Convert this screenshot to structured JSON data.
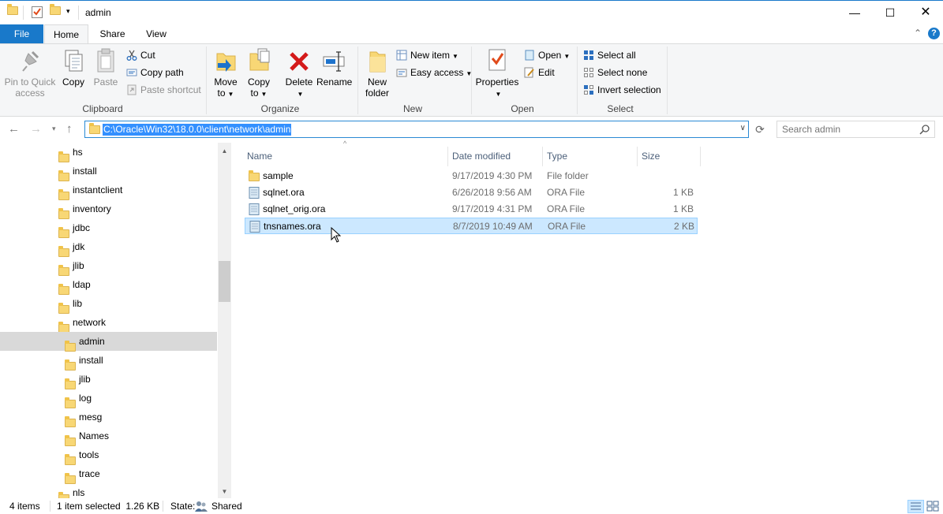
{
  "window": {
    "title": "admin"
  },
  "ribbon_tabs": [
    "File",
    "Home",
    "Share",
    "View"
  ],
  "ribbon": {
    "clipboard": {
      "label": "Clipboard",
      "pin": "Pin to Quick access",
      "pin_l1": "Pin to Quick",
      "pin_l2": "access",
      "copy": "Copy",
      "paste": "Paste",
      "cut": "Cut",
      "copy_path": "Copy path",
      "paste_shortcut": "Paste shortcut"
    },
    "organize": {
      "label": "Organize",
      "move_l1": "Move",
      "move_l2": "to",
      "copy_l1": "Copy",
      "copy_l2": "to",
      "delete": "Delete",
      "rename": "Rename"
    },
    "new": {
      "label": "New",
      "new_folder_l1": "New",
      "new_folder_l2": "folder",
      "new_item": "New item",
      "easy_access": "Easy access"
    },
    "open": {
      "label": "Open",
      "properties": "Properties",
      "open": "Open",
      "edit": "Edit"
    },
    "select": {
      "label": "Select",
      "select_all": "Select all",
      "select_none": "Select none",
      "invert": "Invert selection"
    }
  },
  "address": {
    "path": "C:\\Oracle\\Win32\\18.0.0\\client\\network\\admin",
    "search_placeholder": "Search admin"
  },
  "tree": [
    {
      "label": "hs",
      "level": 0
    },
    {
      "label": "install",
      "level": 0
    },
    {
      "label": "instantclient",
      "level": 0
    },
    {
      "label": "inventory",
      "level": 0
    },
    {
      "label": "jdbc",
      "level": 0
    },
    {
      "label": "jdk",
      "level": 0
    },
    {
      "label": "jlib",
      "level": 0
    },
    {
      "label": "ldap",
      "level": 0
    },
    {
      "label": "lib",
      "level": 0
    },
    {
      "label": "network",
      "level": 0
    },
    {
      "label": "admin",
      "level": 1,
      "selected": true
    },
    {
      "label": "install",
      "level": 1
    },
    {
      "label": "jlib",
      "level": 1
    },
    {
      "label": "log",
      "level": 1
    },
    {
      "label": "mesg",
      "level": 1
    },
    {
      "label": "Names",
      "level": 1
    },
    {
      "label": "tools",
      "level": 1
    },
    {
      "label": "trace",
      "level": 1
    },
    {
      "label": "nls",
      "level": 0
    }
  ],
  "columns": [
    "Name",
    "Date modified",
    "Type",
    "Size"
  ],
  "files": [
    {
      "name": "sample",
      "date": "9/17/2019 4:30 PM",
      "type": "File folder",
      "size": "",
      "kind": "folder"
    },
    {
      "name": "sqlnet.ora",
      "date": "6/26/2018 9:56 AM",
      "type": "ORA File",
      "size": "1 KB",
      "kind": "file"
    },
    {
      "name": "sqlnet_orig.ora",
      "date": "9/17/2019 4:31 PM",
      "type": "ORA File",
      "size": "1 KB",
      "kind": "file"
    },
    {
      "name": "tnsnames.ora",
      "date": "8/7/2019 10:49 AM",
      "type": "ORA File",
      "size": "2 KB",
      "kind": "file",
      "selected": true
    }
  ],
  "status": {
    "items": "4 items",
    "selected": "1 item selected  1.26 KB",
    "state_label": "State:",
    "state_value": "Shared"
  },
  "colors": {
    "accent": "#1979ca",
    "selection": "#cce8ff",
    "folder": "#f8d775"
  }
}
